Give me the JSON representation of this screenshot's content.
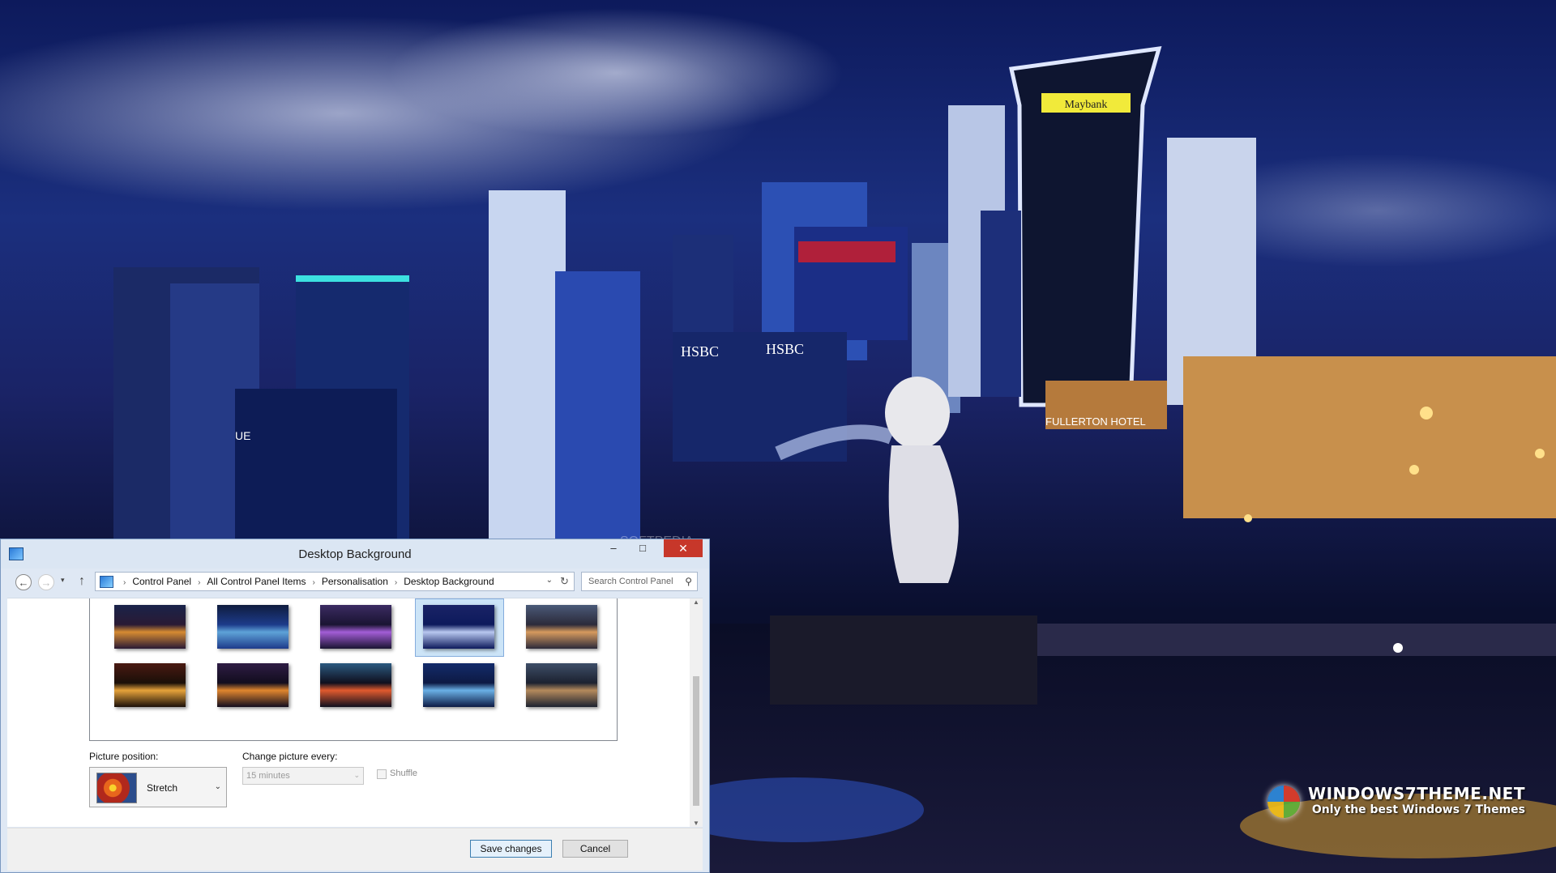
{
  "window": {
    "title": "Desktop Background",
    "min_glyph": "–",
    "max_glyph": "□",
    "close_glyph": "✕"
  },
  "nav": {
    "back": "←",
    "forward": "→",
    "recent": "▾",
    "up": "↑",
    "refresh": "↻"
  },
  "address": {
    "crumbs": [
      "Control Panel",
      "All Control Panel Items",
      "Personalisation",
      "Desktop Background"
    ],
    "separator": "›",
    "dropdown": "⌄"
  },
  "search": {
    "placeholder": "Search Control Panel",
    "icon": "⚲"
  },
  "wallpapers": [
    {
      "name": "thumb-1",
      "colors": [
        "#2a1a34",
        "#d68b32",
        "#19234a"
      ]
    },
    {
      "name": "thumb-2",
      "colors": [
        "#1d3b8a",
        "#5ea3d8",
        "#0f1c3e"
      ]
    },
    {
      "name": "thumb-3",
      "colors": [
        "#1a1432",
        "#a35dd6",
        "#3b2b62"
      ]
    },
    {
      "name": "thumb-4",
      "colors": [
        "#0d1a5c",
        "#b8c8f0",
        "#1a2366"
      ],
      "selected": true
    },
    {
      "name": "thumb-5",
      "colors": [
        "#2c2a3a",
        "#d69a5e",
        "#4a5a78"
      ]
    },
    {
      "name": "thumb-6",
      "colors": [
        "#1a0f08",
        "#e6a23a",
        "#4a1a12"
      ]
    },
    {
      "name": "thumb-7",
      "colors": [
        "#120d1e",
        "#e0862e",
        "#2e1c44"
      ]
    },
    {
      "name": "thumb-8",
      "colors": [
        "#0f0f1e",
        "#e05a2e",
        "#2c5a80"
      ]
    },
    {
      "name": "thumb-9",
      "colors": [
        "#0d1a44",
        "#6ab0e6",
        "#132b6a"
      ]
    },
    {
      "name": "thumb-10",
      "colors": [
        "#1c2230",
        "#b48a5c",
        "#3e4e68"
      ]
    }
  ],
  "picture_position": {
    "label": "Picture position:",
    "value": "Stretch",
    "dropdown": "⌄"
  },
  "change_picture": {
    "label": "Change picture every:",
    "value": "15 minutes",
    "dropdown": "⌄"
  },
  "shuffle": {
    "label": "Shuffle",
    "checked": false
  },
  "buttons": {
    "save": "Save changes",
    "cancel": "Cancel"
  },
  "scroll": {
    "up": "▲",
    "down": "▼"
  },
  "watermark": {
    "title": "WINDOWS7THEME.NET",
    "subtitle": "Only the best Windows 7 Themes"
  },
  "billboards": {
    "bank": "Maybank",
    "hsbc_1": "HSBC",
    "hsbc_2": "HSBC",
    "hotel": "FULLERTON HOTEL",
    "ue": "UE",
    "softpedia": "SOFTPEDIA"
  }
}
